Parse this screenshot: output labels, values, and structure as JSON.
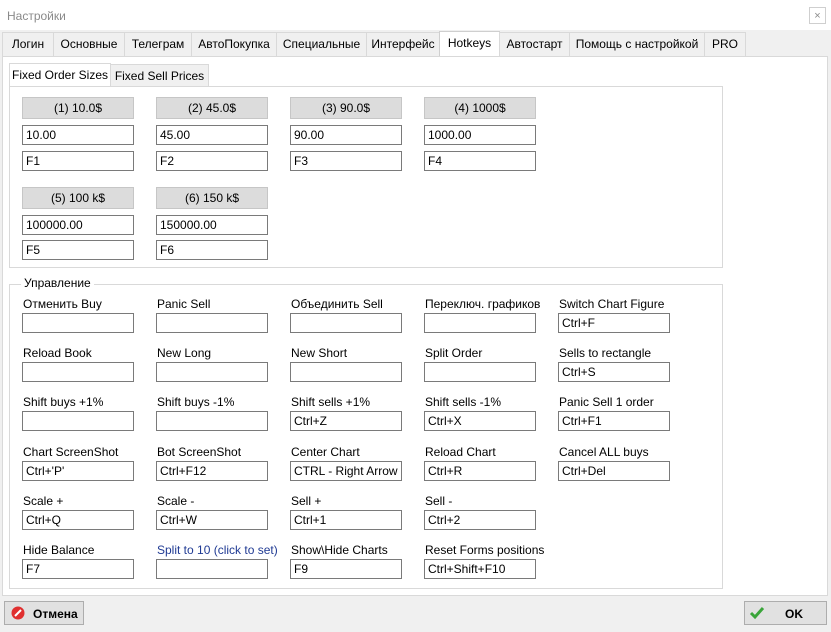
{
  "window": {
    "title": "Настройки",
    "close": "×"
  },
  "tabs": [
    "Логин",
    "Основные",
    "Телеграм",
    "АвтоПокупка",
    "Специальные",
    "Интерфейс",
    "Hotkeys",
    "Автостарт",
    "Помощь с настройкой",
    "PRO"
  ],
  "subtabs": [
    "Fixed Order Sizes",
    "Fixed Sell Prices"
  ],
  "fixed_orders": [
    {
      "button": "(1)  10.0$",
      "value": "10.00",
      "hotkey": "F1"
    },
    {
      "button": "(2)  45.0$",
      "value": "45.00",
      "hotkey": "F2"
    },
    {
      "button": "(3)  90.0$",
      "value": "90.00",
      "hotkey": "F3"
    },
    {
      "button": "(4)  1000$",
      "value": "1000.00",
      "hotkey": "F4"
    },
    {
      "button": "(5)  100 k$",
      "value": "100000.00",
      "hotkey": "F5"
    },
    {
      "button": "(6)  150 k$",
      "value": "150000.00",
      "hotkey": "F6"
    }
  ],
  "control": {
    "title": "Управление",
    "items": [
      {
        "label": "Отменить Buy",
        "value": ""
      },
      {
        "label": "Panic Sell",
        "value": ""
      },
      {
        "label": "Объединить Sell",
        "value": ""
      },
      {
        "label": "Переключ. графиков",
        "value": ""
      },
      {
        "label": "Switch Chart Figure",
        "value": "Ctrl+F"
      },
      {
        "label": "Reload Book",
        "value": ""
      },
      {
        "label": "New Long",
        "value": ""
      },
      {
        "label": "New Short",
        "value": ""
      },
      {
        "label": "Split Order",
        "value": ""
      },
      {
        "label": "Sells to rectangle",
        "value": "Ctrl+S"
      },
      {
        "label": "Shift buys +1%",
        "value": ""
      },
      {
        "label": "Shift buys -1%",
        "value": ""
      },
      {
        "label": "Shift sells +1%",
        "value": "Ctrl+Z"
      },
      {
        "label": "Shift sells -1%",
        "value": "Ctrl+X"
      },
      {
        "label": "Panic Sell 1 order",
        "value": "Ctrl+F1"
      },
      {
        "label": "Chart ScreenShot",
        "value": "Ctrl+'P'"
      },
      {
        "label": "Bot ScreenShot",
        "value": "Ctrl+F12"
      },
      {
        "label": "Center Chart",
        "value": "CTRL - Right Arrow"
      },
      {
        "label": "Reload Chart",
        "value": "Ctrl+R"
      },
      {
        "label": "Cancel ALL buys",
        "value": "Ctrl+Del"
      },
      {
        "label": "Scale +",
        "value": "Ctrl+Q"
      },
      {
        "label": "Scale -",
        "value": "Ctrl+W"
      },
      {
        "label": "Sell +",
        "value": "Ctrl+1"
      },
      {
        "label": "Sell -",
        "value": "Ctrl+2"
      },
      {
        "label": "Hide Balance",
        "value": "F7"
      },
      {
        "label": "Split to 10 (click to set)",
        "value": ""
      },
      {
        "label": "Show\\Hide Charts",
        "value": "F9"
      },
      {
        "label": "Reset Forms positions",
        "value": "Ctrl+Shift+F10"
      }
    ]
  },
  "buttons": {
    "cancel": "Отмена",
    "ok": "OK"
  },
  "colors": {
    "link": "#1f3a93",
    "cancel_icon": "#e03030",
    "ok_icon": "#3aa53a"
  }
}
